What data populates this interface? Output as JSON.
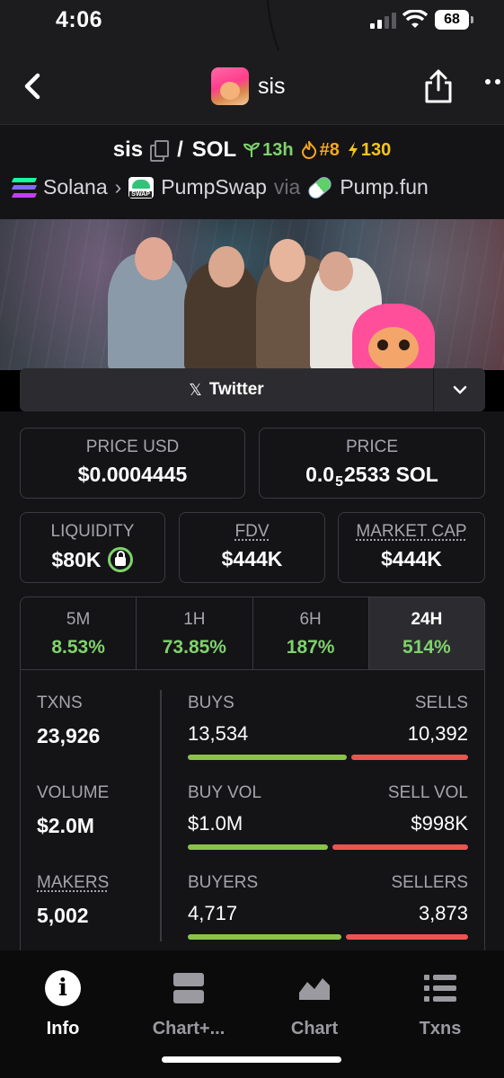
{
  "status": {
    "time": "4:06",
    "battery": "68"
  },
  "nav": {
    "title": "sis"
  },
  "pair": {
    "base": "sis",
    "separator": "/",
    "quote": "SOL",
    "age": "13h",
    "rank": "#8",
    "boosts": "130",
    "chain": "Solana",
    "dex": "PumpSwap",
    "via": "via",
    "launchpad": "Pump.fun"
  },
  "social": {
    "twitter_label": "Twitter"
  },
  "price": {
    "usd_label": "PRICE USD",
    "usd_value": "$0.0004445",
    "native_label": "PRICE",
    "native_prefix": "0.0",
    "native_zeros": "5",
    "native_rest": "2533 SOL"
  },
  "metrics": {
    "liquidity_label": "LIQUIDITY",
    "liquidity_value": "$80K",
    "fdv_label": "FDV",
    "fdv_value": "$444K",
    "mcap_label": "MARKET CAP",
    "mcap_value": "$444K"
  },
  "periods": [
    {
      "label": "5M",
      "change": "8.53%"
    },
    {
      "label": "1H",
      "change": "73.85%"
    },
    {
      "label": "6H",
      "change": "187%"
    },
    {
      "label": "24H",
      "change": "514%"
    }
  ],
  "stats": {
    "txns_label": "TXNS",
    "txns_value": "23,926",
    "volume_label": "VOLUME",
    "volume_value": "$2.0M",
    "makers_label": "MAKERS",
    "makers_value": "5,002",
    "buys_label": "BUYS",
    "buys_value": "13,534",
    "sells_label": "SELLS",
    "sells_value": "10,392",
    "buyvol_label": "BUY VOL",
    "buyvol_value": "$1.0M",
    "sellvol_label": "SELL VOL",
    "sellvol_value": "$998K",
    "buyers_label": "BUYERS",
    "buyers_value": "4,717",
    "sellers_label": "SELLERS",
    "sellers_value": "3,873",
    "buy_share": 0.566,
    "buyvol_share": 0.5,
    "buyers_share": 0.549
  },
  "tabbar": [
    {
      "label": "Info",
      "icon": "info-icon"
    },
    {
      "label": "Chart+...",
      "icon": "chart-plus-icon"
    },
    {
      "label": "Chart",
      "icon": "chart-icon"
    },
    {
      "label": "Txns",
      "icon": "list-icon"
    }
  ],
  "colors": {
    "positive": "#7fd36b",
    "buy_bar": "#8bc34a",
    "sell_bar": "#ef5350"
  }
}
